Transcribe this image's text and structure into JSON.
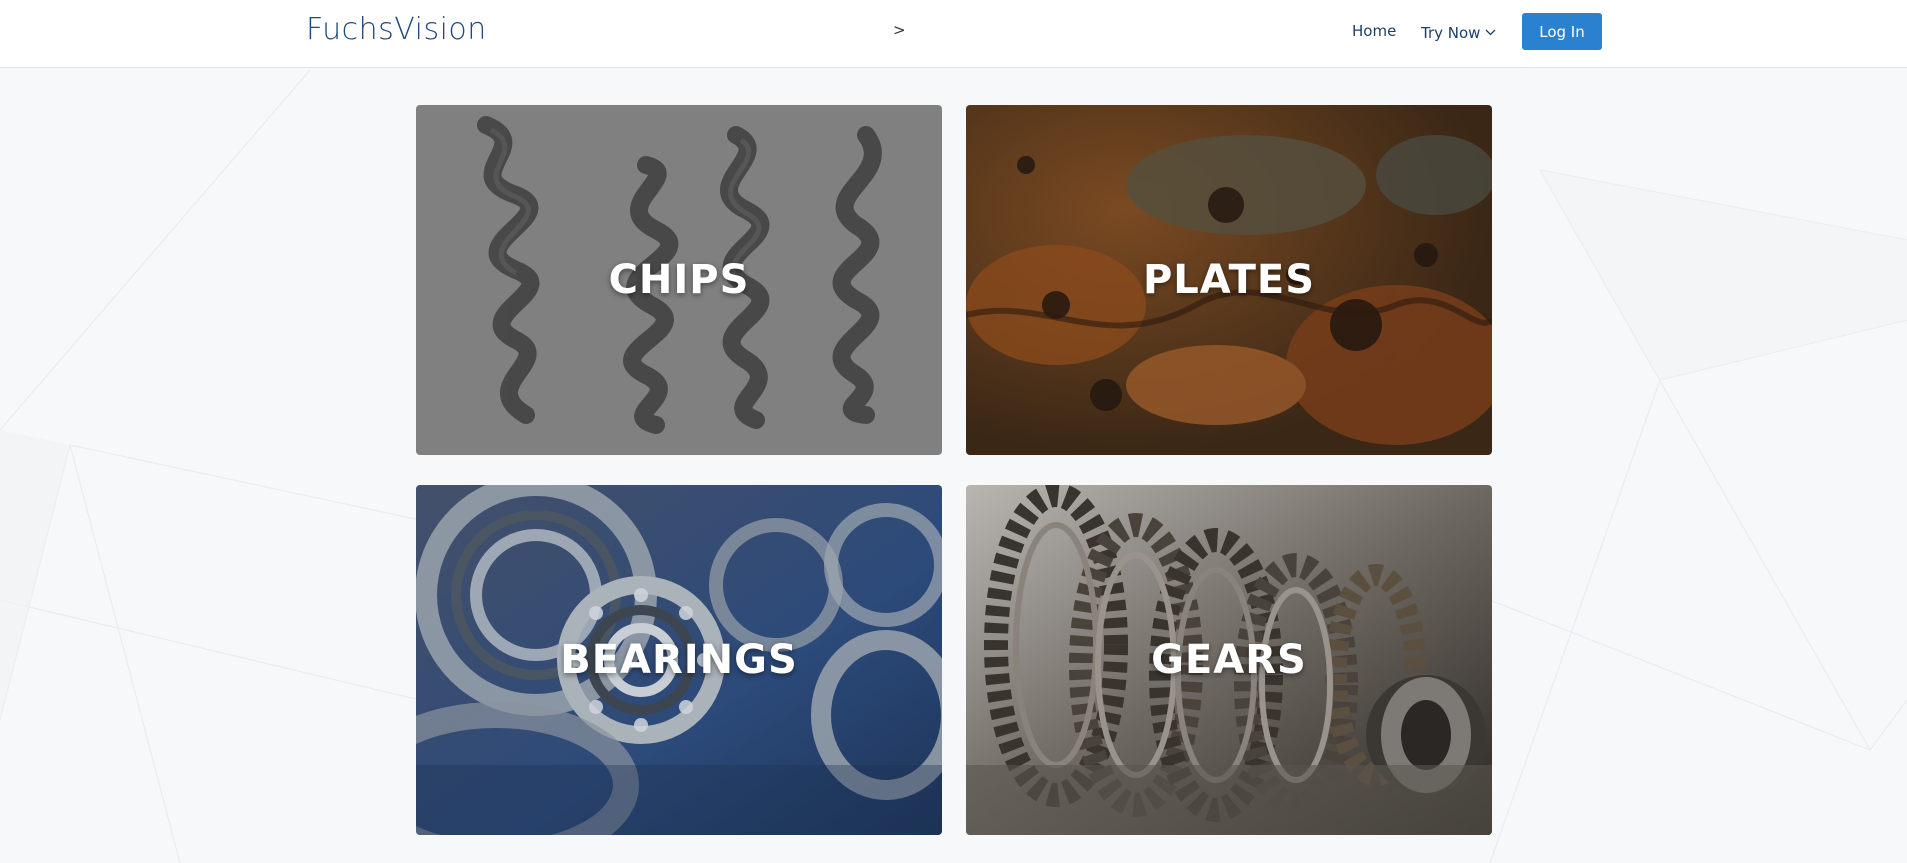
{
  "brand": {
    "name": "FuchsVision"
  },
  "breadcrumb": {
    "separator": ">"
  },
  "nav": {
    "home_label": "Home",
    "try_now_label": "Try Now",
    "login_label": "Log In"
  },
  "tiles": [
    {
      "label": "CHIPS"
    },
    {
      "label": "PLATES"
    },
    {
      "label": "BEARINGS"
    },
    {
      "label": "GEARS"
    }
  ],
  "colors": {
    "brand": "#1f4a7a",
    "accent": "#2a81cf",
    "background": "#f7f8f9"
  },
  "icons": {
    "try_now_dropdown": "chevron-down-icon"
  }
}
